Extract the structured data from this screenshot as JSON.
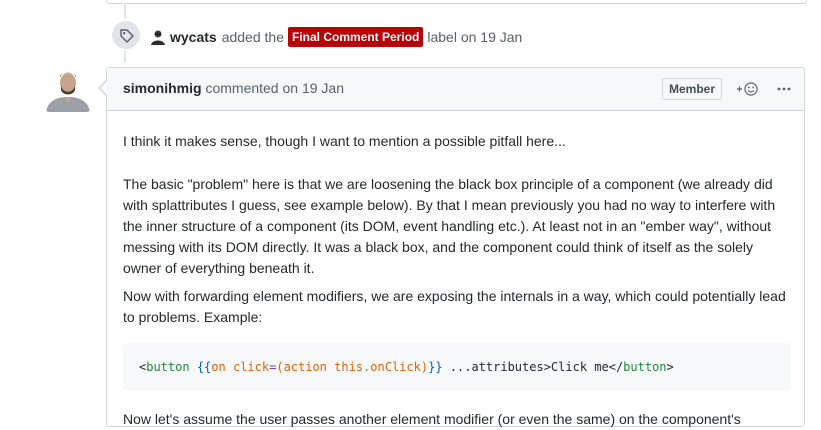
{
  "event": {
    "actor": "wycats",
    "action": "added the",
    "label": "Final Comment Period",
    "suffix": "label on 19 Jan",
    "label_color": "#b60205"
  },
  "comment": {
    "author": "simonihmig",
    "action": "commented on 19 Jan",
    "badge": "Member",
    "reaction_icon": "smiley-plus-icon",
    "more_icon": "kebab-horizontal-icon",
    "body": {
      "p1": "I think it makes sense, though I want to mention a possible pitfall here...",
      "p2": "The basic \"problem\" here is that we are loosening the black box principle of a component (we already did with splattributes I guess, see example below). By that I mean previously you had no way to interfere with the inner structure of a component (its DOM, event handling etc.). At least not in an \"ember way\", without messing with its DOM directly. It was a black box, and the component could think of itself as the solely owner of everything beneath it.",
      "p3": "Now with forwarding element modifiers, we are exposing the internals in a way, which could potentially lead to problems. Example:",
      "code": {
        "open_lt": "<",
        "tag": "button",
        "sp1": " ",
        "mustache_open": "{{",
        "helper": "on",
        "sp2": " ",
        "attr": "click",
        "eq": "=",
        "paren_open": "(",
        "action_kw": "action",
        "sp3": " ",
        "this_ref": "this.onClick",
        "paren_close": ")",
        "mustache_close": "}}",
        "rest": " ...attributes>Click me</",
        "close_tag": "button",
        "close_gt": ">"
      },
      "p4": "Now let's assume the user passes another element modifier (or even the same) on the component's"
    }
  }
}
